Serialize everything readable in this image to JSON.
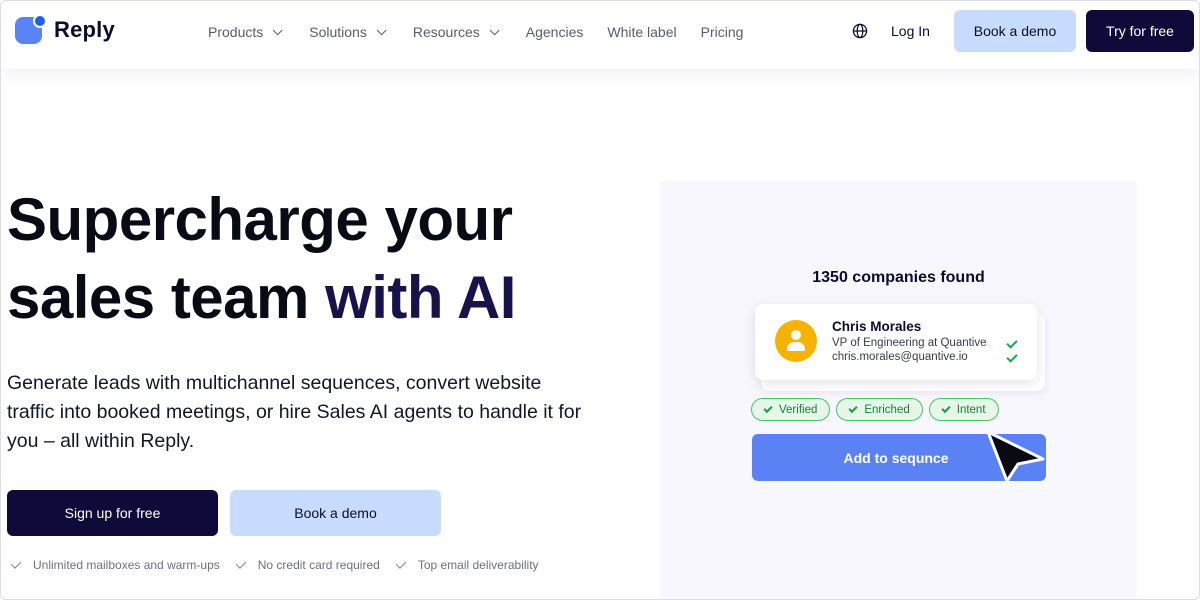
{
  "header": {
    "logo_text": "Reply",
    "nav": [
      {
        "label": "Products",
        "dropdown": true
      },
      {
        "label": "Solutions",
        "dropdown": true
      },
      {
        "label": "Resources",
        "dropdown": true
      },
      {
        "label": "Agencies",
        "dropdown": false
      },
      {
        "label": "White label",
        "dropdown": false
      },
      {
        "label": "Pricing",
        "dropdown": false
      }
    ],
    "globe_icon": "globe-icon",
    "login_label": "Log In",
    "book_demo_label": "Book a demo",
    "try_free_label": "Try for free"
  },
  "hero": {
    "headline_line1": "Supercharge your",
    "headline_line2_plain": "sales team ",
    "headline_line2_accent": "with AI",
    "subtext": "Generate leads with multichannel sequences, convert website traffic into booked meetings, or hire Sales AI agents to handle it for you – all within Reply.",
    "signup_label": "Sign up for free",
    "book_demo_label": "Book a demo",
    "perks": [
      "Unlimited mailboxes and warm-ups",
      "No credit card required",
      "Top email deliverability"
    ]
  },
  "panel": {
    "found_text": "1350 companies found",
    "contact": {
      "name": "Chris Morales",
      "role": "VP of Engineering at Quantive",
      "email": "chris.morales@quantive.io"
    },
    "chips": [
      "Verified",
      "Enriched",
      "Intent"
    ],
    "add_button_label": "Add to sequnce"
  },
  "colors": {
    "brand_dark": "#0e0b3a",
    "brand_light": "#c8dcff",
    "accent_blue": "#5b82f5",
    "avatar_yellow": "#f5b300",
    "success_green": "#1fa84a"
  }
}
